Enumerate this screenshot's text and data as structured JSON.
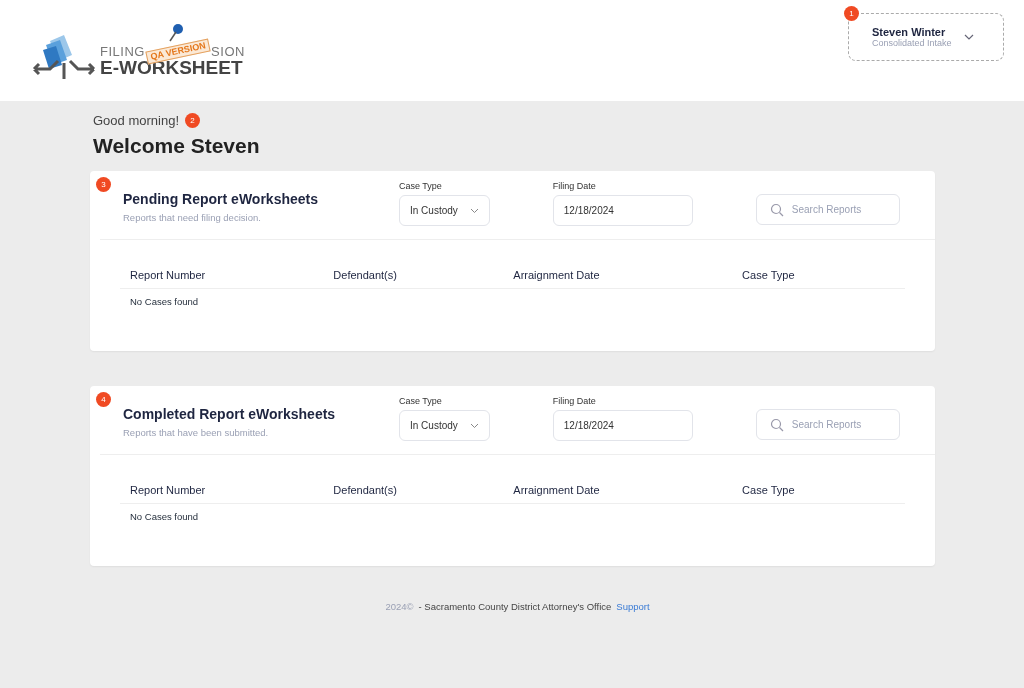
{
  "logo": {
    "line_1_left": "FILING",
    "line_1_right": "SION",
    "line_2": "E-WORKSHEET",
    "tag": "QA VERSION"
  },
  "user_menu": {
    "badge": "1",
    "name": "Steven Winter",
    "role": "Consolidated Intake"
  },
  "greeting": {
    "text": "Good morning!",
    "badge": "2"
  },
  "title": "Welcome Steven",
  "sections": [
    {
      "badge": "3",
      "title": "Pending Report eWorksheets",
      "subtitle": "Reports that need filing decision.",
      "case_type_label": "Case Type",
      "case_type": "In Custody",
      "filing_date_label": "Filing Date",
      "filing_date": "12/18/2024",
      "search_placeholder": "Search Reports",
      "columns": [
        "Report Number",
        "Defendant(s)",
        "Arraignment Date",
        "Case Type"
      ],
      "empty_text": "No Cases found"
    },
    {
      "badge": "4",
      "title": "Completed Report eWorksheets",
      "subtitle": "Reports that have been submitted.",
      "case_type_label": "Case Type",
      "case_type": "In Custody",
      "filing_date_label": "Filing Date",
      "filing_date": "12/18/2024",
      "search_placeholder": "Search Reports",
      "columns": [
        "Report Number",
        "Defendant(s)",
        "Arraignment Date",
        "Case Type"
      ],
      "empty_text": "No Cases found"
    }
  ],
  "footer": {
    "year": "2024©",
    "text": "- Sacramento County District Attorney's Office",
    "link": "Support"
  }
}
